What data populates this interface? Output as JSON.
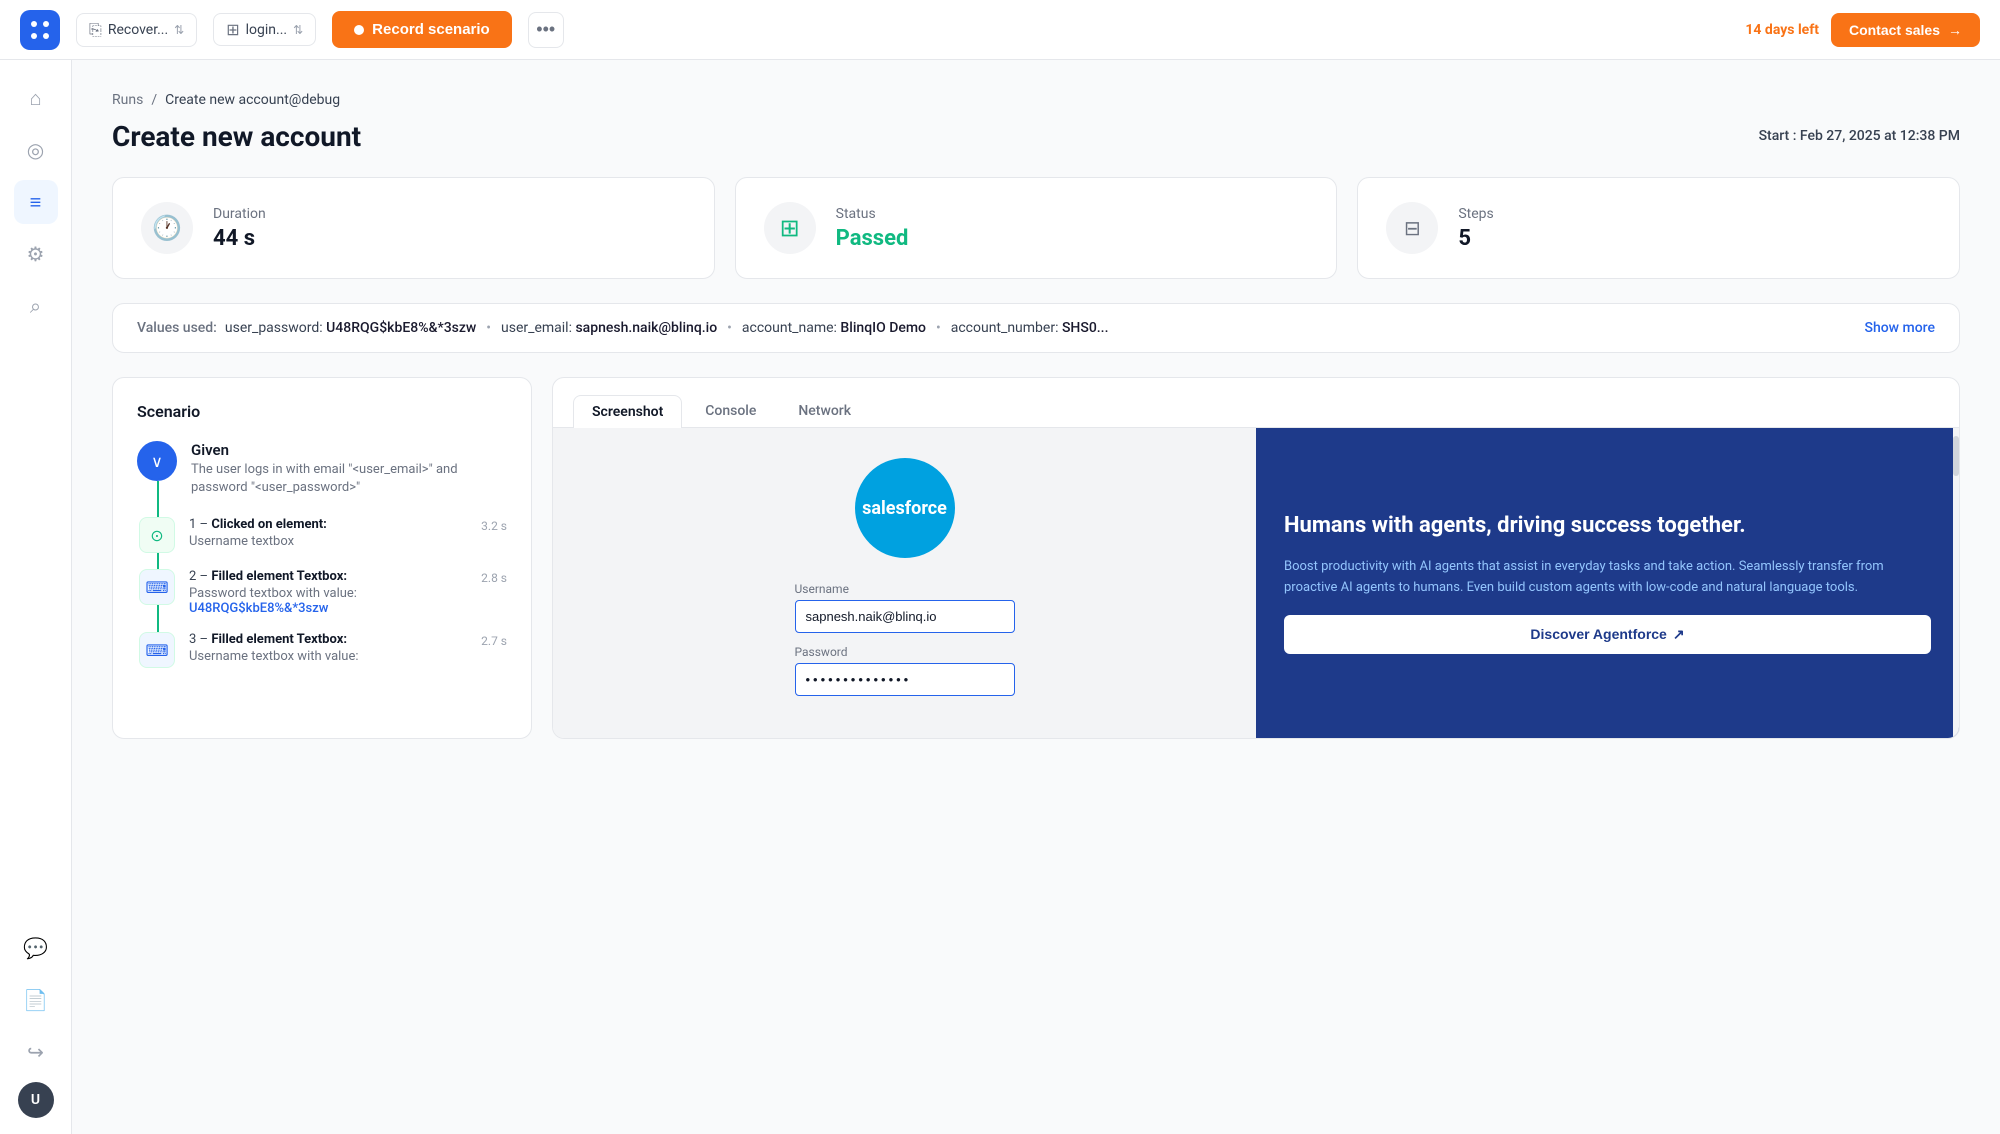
{
  "topbar": {
    "logo_alt": "BlinqIO Logo",
    "selector1_label": "Recover...",
    "selector2_label": "login...",
    "record_btn_label": "Record scenario",
    "more_btn_label": "...",
    "days_left_pre": "14 days",
    "days_left_post": "left",
    "contact_btn_label": "Contact sales"
  },
  "sidebar": {
    "items": [
      {
        "name": "home",
        "icon": "⌂",
        "active": false
      },
      {
        "name": "tests",
        "icon": "◎",
        "active": false
      },
      {
        "name": "runs",
        "icon": "≡",
        "active": true
      },
      {
        "name": "settings",
        "icon": "⚙",
        "active": false
      },
      {
        "name": "search",
        "icon": "⌕",
        "active": false
      }
    ],
    "bottom_items": [
      {
        "name": "chat",
        "icon": "💬"
      },
      {
        "name": "docs",
        "icon": "📄"
      },
      {
        "name": "logout",
        "icon": "→"
      }
    ],
    "avatar_initials": "U"
  },
  "breadcrumb": {
    "parent_label": "Runs",
    "separator": "/",
    "current_label": "Create new account@debug"
  },
  "page": {
    "title": "Create new account",
    "start_label": "Start :",
    "start_time": "Feb 27, 2025 at 12:38 PM"
  },
  "stats": {
    "duration": {
      "label": "Duration",
      "value": "44 s"
    },
    "status": {
      "label": "Status",
      "value": "Passed"
    },
    "steps": {
      "label": "Steps",
      "value": "5"
    }
  },
  "values_bar": {
    "prefix": "Values used:",
    "items": [
      {
        "key": "user_password:",
        "val": "U48RQG$kbE8%&*3szw"
      },
      {
        "key": "user_email:",
        "val": "sapnesh.naik@blinq.io"
      },
      {
        "key": "account_name:",
        "val": "BlinqIO Demo"
      },
      {
        "key": "account_number:",
        "val": "SHS0..."
      }
    ],
    "show_more": "Show more"
  },
  "scenario": {
    "title": "Scenario",
    "given_label": "Given",
    "given_desc": "The user logs in with email \"<user_email>\" and password \"<user_password>\"",
    "steps": [
      {
        "number": "1",
        "action": "Clicked on element:",
        "detail": "Username textbox",
        "time": "3.2 s"
      },
      {
        "number": "2",
        "action": "Filled element Textbox:",
        "detail": "Password textbox with value:",
        "link": "U48RQG$kbE8%&*3szw",
        "time": "2.8 s"
      },
      {
        "number": "3",
        "action": "Filled element Textbox:",
        "detail": "Username textbox with value:",
        "time": "2.7 s"
      }
    ]
  },
  "screenshot_panel": {
    "tabs": [
      {
        "label": "Screenshot",
        "active": true
      },
      {
        "label": "Console",
        "active": false
      },
      {
        "label": "Network",
        "active": false
      }
    ],
    "sf": {
      "logo_text": "salesforce",
      "username_label": "Username",
      "username_value": "sapnesh.naik@blinq.io",
      "password_label": "Password",
      "password_value": "••••••••••••••",
      "headline": "Humans with agents, driving success together.",
      "body": "Boost productivity with AI agents that assist in everyday tasks and take action. Seamlessly transfer from proactive AI agents to humans. Even build custom agents with low-code and natural language tools.",
      "discover_btn": "Discover Agentforce"
    }
  }
}
